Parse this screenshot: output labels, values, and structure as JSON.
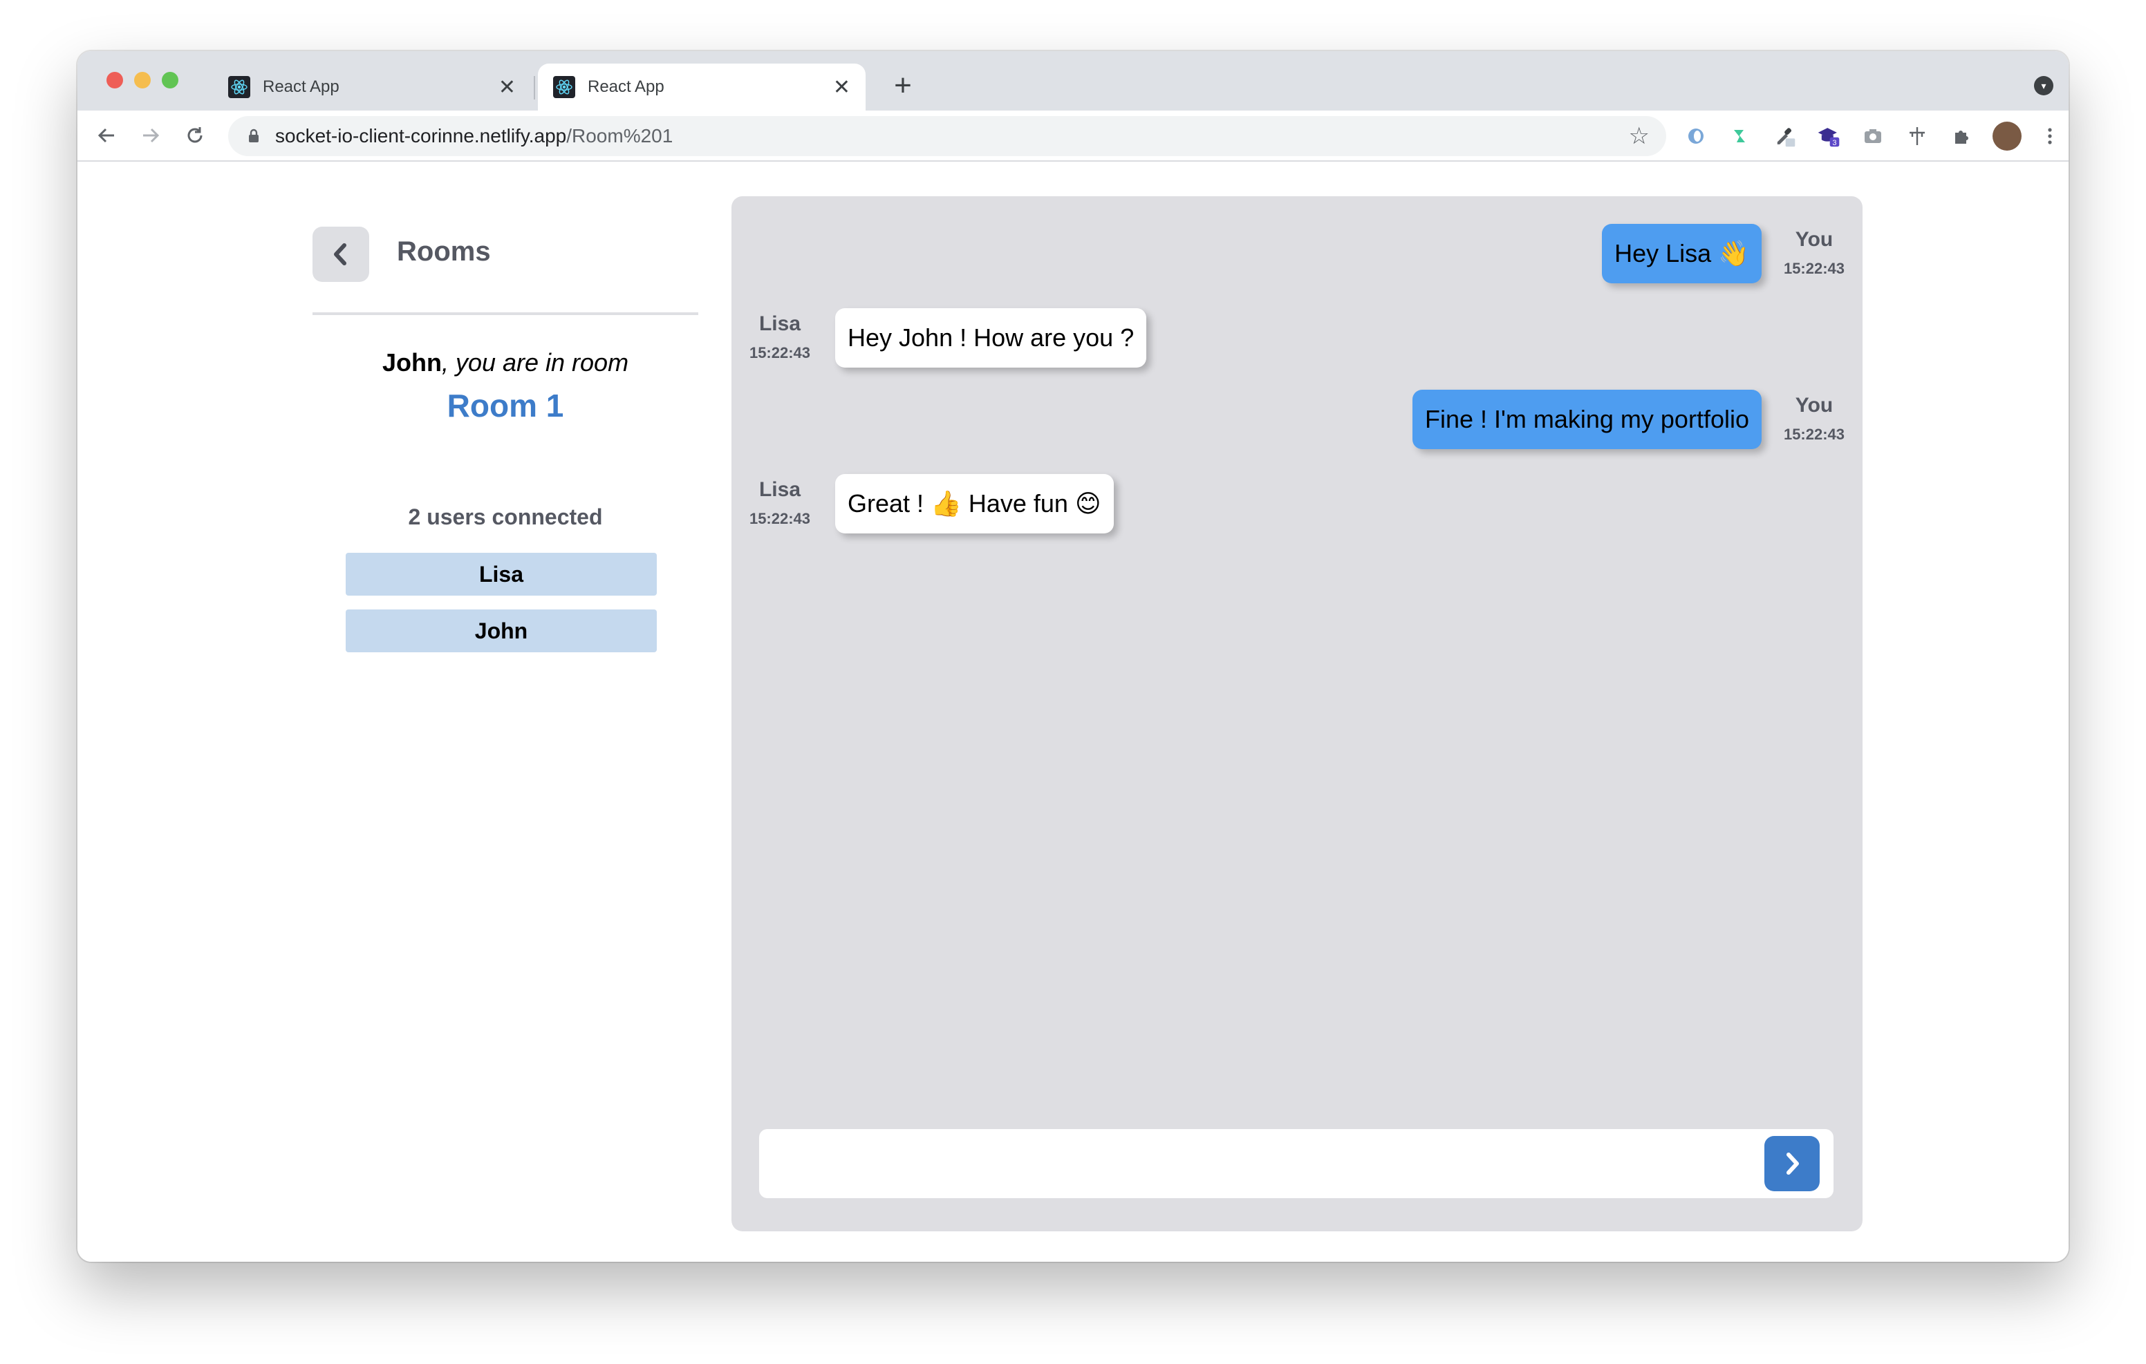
{
  "browser": {
    "tabs": [
      {
        "title": "React App",
        "close": "✕"
      },
      {
        "title": "React App",
        "close": "✕"
      }
    ],
    "new_tab": "+",
    "url_host": "socket-io-client-corinne.netlify.app",
    "url_path": "/Room%201",
    "extension_badge": "3"
  },
  "sidebar": {
    "header_title": "Rooms",
    "welcome_name": "John",
    "welcome_text": ", you are in room",
    "room_name": "Room 1",
    "users_count_label": "2 users connected",
    "users": [
      "Lisa",
      "John"
    ]
  },
  "chat": {
    "messages": [
      {
        "author": "You",
        "time": "15:22:43",
        "text": "Hey Lisa 👋",
        "mine": true
      },
      {
        "author": "Lisa",
        "time": "15:22:43",
        "text": "Hey John ! How are you ?",
        "mine": false
      },
      {
        "author": "You",
        "time": "15:22:43",
        "text": "Fine ! I'm making my portfolio",
        "mine": true
      },
      {
        "author": "Lisa",
        "time": "15:22:43",
        "text": "Great ! 👍 Have fun 😊",
        "mine": false
      }
    ],
    "input_placeholder": "",
    "input_value": ""
  },
  "colors": {
    "accent": "#3d7cc9",
    "my_bubble": "#4e9df0",
    "their_bubble": "#ffffff",
    "chat_background": "#dedee2",
    "user_chip": "#c5d9ee"
  }
}
